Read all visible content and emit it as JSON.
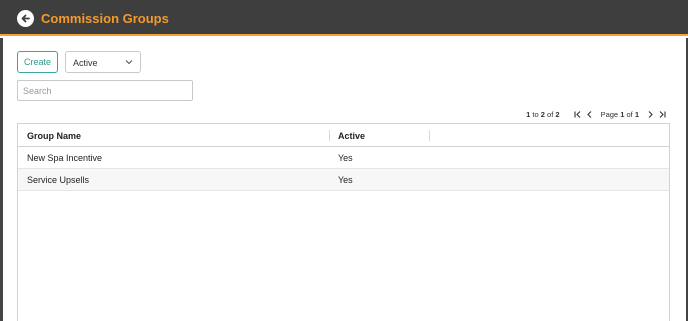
{
  "header": {
    "title": "Commission Groups",
    "back_icon": "back-arrow-icon",
    "accent_color": "#f39a2b",
    "bg_color": "#3e3e3e"
  },
  "toolbar": {
    "create_label": "Create",
    "status_filter": {
      "selected": "Active"
    },
    "search_placeholder": "Search"
  },
  "pagination": {
    "range_start": "1",
    "range_to": "to",
    "range_end": "2",
    "of_label": "of",
    "total": "2",
    "page_label": "Page",
    "current_page": "1",
    "page_of": "of",
    "total_pages": "1"
  },
  "grid": {
    "columns": [
      "Group Name",
      "Active"
    ],
    "rows": [
      {
        "group_name": "New Spa Incentive",
        "active": "Yes"
      },
      {
        "group_name": "Service Upsells",
        "active": "Yes"
      }
    ]
  }
}
